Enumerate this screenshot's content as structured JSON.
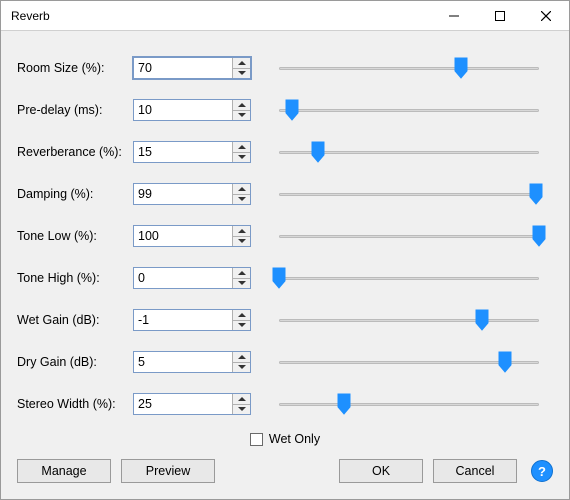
{
  "title": "Reverb",
  "params": [
    {
      "key": "room_size",
      "label": "Room Size (%):",
      "value": "70",
      "pct": 70
    },
    {
      "key": "pre_delay",
      "label": "Pre-delay (ms):",
      "value": "10",
      "pct": 5
    },
    {
      "key": "reverberance",
      "label": "Reverberance (%):",
      "value": "15",
      "pct": 15
    },
    {
      "key": "damping",
      "label": "Damping (%):",
      "value": "99",
      "pct": 99
    },
    {
      "key": "tone_low",
      "label": "Tone Low (%):",
      "value": "100",
      "pct": 100
    },
    {
      "key": "tone_high",
      "label": "Tone High (%):",
      "value": "0",
      "pct": 0
    },
    {
      "key": "wet_gain",
      "label": "Wet Gain (dB):",
      "value": "-1",
      "pct": 78
    },
    {
      "key": "dry_gain",
      "label": "Dry Gain (dB):",
      "value": "5",
      "pct": 87
    },
    {
      "key": "stereo_width",
      "label": "Stereo Width (%):",
      "value": "25",
      "pct": 25
    }
  ],
  "wet_only_label": "Wet Only",
  "wet_only_checked": false,
  "buttons": {
    "manage": "Manage",
    "preview": "Preview",
    "ok": "OK",
    "cancel": "Cancel",
    "help": "?"
  }
}
